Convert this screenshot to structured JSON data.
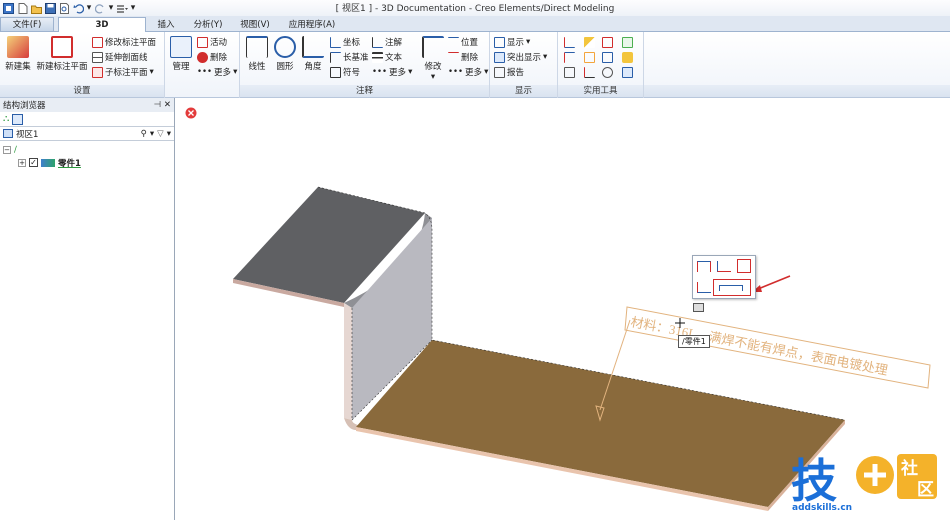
{
  "window": {
    "title": "[ 视区1 ] - 3D Documentation - Creo Elements/Direct Modeling"
  },
  "quick_access": [
    "app-icon",
    "new-icon",
    "open-icon",
    "save-icon",
    "print-preview-icon",
    "undo-icon",
    "redo-icon",
    "customize-icon"
  ],
  "tabs": [
    {
      "label": "文件(F)",
      "active": false
    },
    {
      "label": "3D Documentation",
      "active": true
    },
    {
      "label": "插入",
      "active": false
    },
    {
      "label": "分析(Y)",
      "active": false
    },
    {
      "label": "视图(V)",
      "active": false
    },
    {
      "label": "应用程序(A)",
      "active": false
    }
  ],
  "ribbon": {
    "setup": {
      "label": "设置",
      "new_set": "新建集",
      "new_annotation_plane": "新建标注平面",
      "modify_annotation_plane": "修改标注平面",
      "extend_section_line": "延伸剖面线",
      "sub_annotation_plane": "子标注平面"
    },
    "manage": {
      "label": "管理",
      "active": "活动",
      "delete": "删除",
      "more": "更多"
    },
    "annotation": {
      "label": "注释",
      "linear": "线性",
      "circular": "圆形",
      "angle": "角度",
      "coordinate": "坐标",
      "long_baseline": "长基准",
      "symbol": "符号",
      "note": "注解",
      "text": "文本",
      "more": "更多"
    },
    "modify": {
      "label": "修改",
      "position": "位置",
      "delete": "删除",
      "more": "更多"
    },
    "display": {
      "label": "显示",
      "show": "显示",
      "highlight": "突出显示",
      "report": "报告"
    },
    "tools": {
      "label": "实用工具"
    }
  },
  "browser": {
    "title": "结构浏览器",
    "viewport": "视区1",
    "part": "零件1"
  },
  "viewport": {
    "note": "材料：316L，满焊不能有焊点，表面电镀处理",
    "tooltip": "/零件1"
  },
  "watermark": {
    "logo": "技+社区",
    "url": "addskills.cn"
  },
  "colors": {
    "accent": "#1e5aa8",
    "plate": "#8a6a3c",
    "sheet_dark": "#5f6063",
    "sheet_side": "#b9b9c0",
    "note_border": "#e2b37e"
  }
}
